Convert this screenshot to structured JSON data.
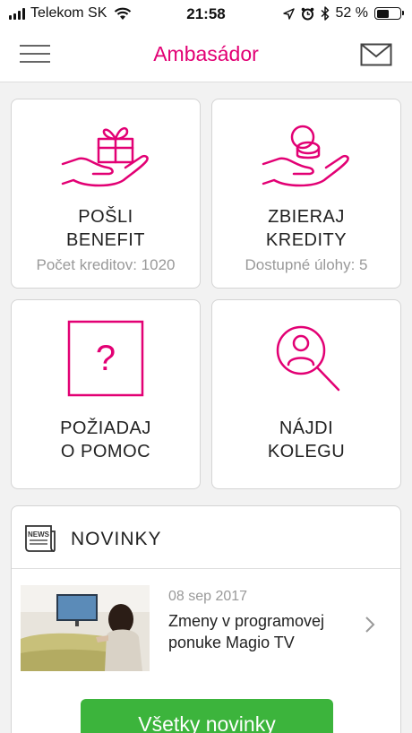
{
  "status_bar": {
    "carrier": "Telekom SK",
    "time": "21:58",
    "battery": "52 %",
    "battery_level": 0.52,
    "icons": [
      "signal-icon",
      "wifi-icon",
      "location-icon",
      "alarm-icon",
      "bluetooth-icon",
      "battery-icon"
    ]
  },
  "nav": {
    "title": "Ambasádor",
    "left_icon": "hamburger-menu-icon",
    "right_icon": "mail-icon"
  },
  "tiles": [
    {
      "icon": "gift-in-hand-icon",
      "line1": "POŠLI",
      "line2": "BENEFIT",
      "sub": "Počet kreditov: 1020"
    },
    {
      "icon": "coins-in-hand-icon",
      "line1": "ZBIERAJ",
      "line2": "KREDITY",
      "sub": "Dostupné úlohy: 5"
    },
    {
      "icon": "question-box-icon",
      "line1": "POŽIADAJ",
      "line2": "O POMOC"
    },
    {
      "icon": "person-search-icon",
      "line1": "NÁJDI",
      "line2": "KOLEGU"
    }
  ],
  "news": {
    "title": "NOVINKY",
    "icon": "news-icon",
    "items": [
      {
        "date": "08 sep 2017",
        "headline": "Zmeny v programovej ponuke Magio TV",
        "thumbnail": "woman-watching-tv-photo"
      }
    ],
    "all_button": "Všetky novinky"
  },
  "colors": {
    "brand_magenta": "#e20074",
    "button_green": "#3cb43c",
    "background": "#f2f2f2"
  }
}
